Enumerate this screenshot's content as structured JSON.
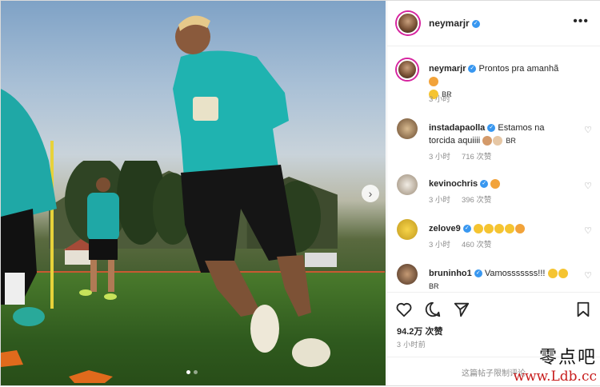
{
  "post": {
    "username": "neymarjr",
    "more_label": "•••",
    "caption_username": "neymarjr",
    "caption": "Pronto​s pra amanhã",
    "caption_sub": "BR",
    "caption_time": "3 小时",
    "comments": [
      {
        "username": "instadapaolla",
        "text": "Estamos na torcida aquiiii",
        "suffix": "BR",
        "time": "3 小时",
        "likes": "716 次赞"
      },
      {
        "username": "kevinochris",
        "text": "",
        "suffix": "",
        "time": "3 小时",
        "likes": "396 次赞"
      },
      {
        "username": "zelove9",
        "text": "",
        "suffix": "",
        "time": "3 小时",
        "likes": "460 次赞"
      },
      {
        "username": "bruninho1",
        "text": "Vamosssssss!!!",
        "suffix": "BR",
        "time": "",
        "likes": ""
      }
    ],
    "likes": "94.2万 次赞",
    "posted_time": "3 小时前",
    "comments_closed": "这篇帖子限制评论"
  },
  "watermark": {
    "line1": "零点吧",
    "line2": "www.Ldb.cc"
  },
  "carousel": {
    "next_icon": "chevron-right-icon",
    "count": 2,
    "active": 0
  },
  "colors": {
    "verified": "#3897f0",
    "accent_ring": "#d6249f"
  }
}
